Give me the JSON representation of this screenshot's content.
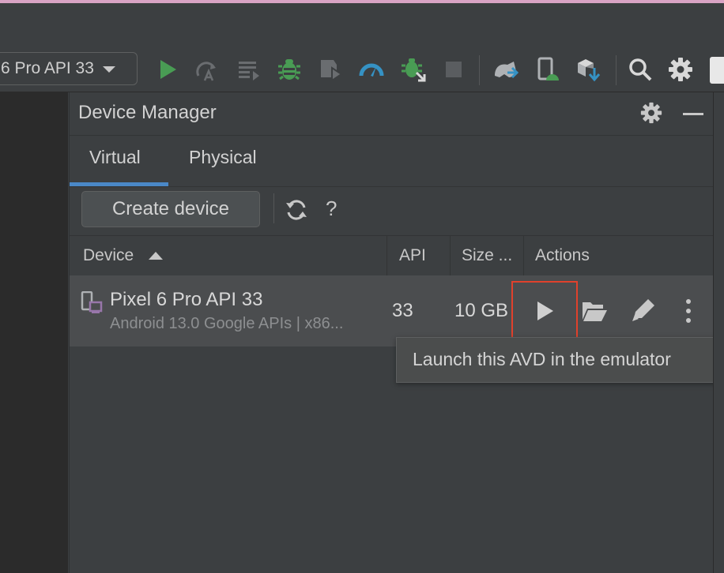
{
  "toolbar": {
    "device_selector": "6 Pro API 33",
    "icons": [
      "run-icon",
      "apply-changes-icon",
      "apply-code-changes-icon",
      "debug-icon",
      "attach-debugger-icon",
      "profile-icon",
      "debug-attach-icon",
      "stop-icon",
      "sync-gradle-icon",
      "device-manager-icon",
      "sdk-manager-icon",
      "search-icon",
      "settings-icon",
      "avatar-icon"
    ]
  },
  "panel": {
    "title": "Device Manager",
    "tabs": [
      {
        "label": "Virtual",
        "selected": true
      },
      {
        "label": "Physical",
        "selected": false
      }
    ],
    "create_button": "Create device",
    "help_label": "?",
    "table": {
      "headers": [
        "Device",
        "API",
        "Size ...",
        "Actions"
      ],
      "rows": [
        {
          "name": "Pixel 6 Pro API 33",
          "subtitle": "Android 13.0 Google APIs | x86...",
          "api": "33",
          "size": "10 GB"
        }
      ]
    },
    "tooltip": "Launch this AVD in the emulator"
  },
  "colors": {
    "background": "#3c3f41",
    "accent": "#4a88c7",
    "run_green": "#499c54",
    "highlight_red": "#e0412c"
  }
}
